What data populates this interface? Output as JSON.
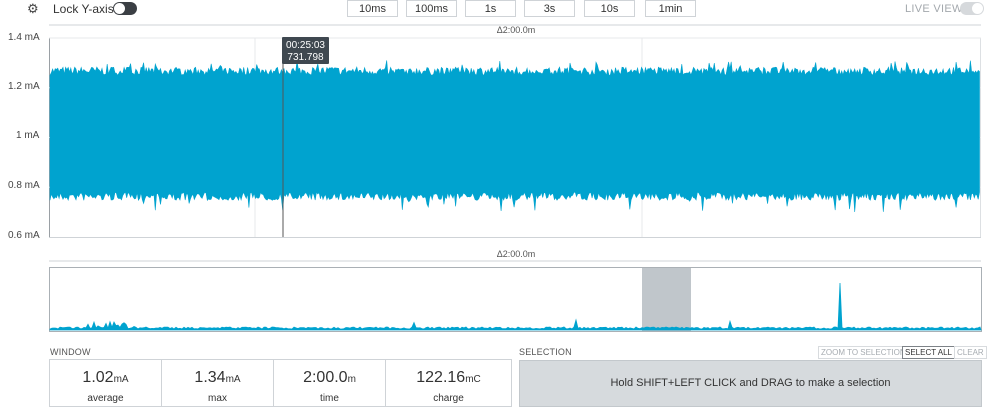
{
  "topbar": {
    "lock_y_axis_label": "Lock Y-axis",
    "lock_y_axis_on": true,
    "live_view_label": "LIVE VIEW",
    "live_view_on": false,
    "window_buttons": [
      "10ms",
      "100ms",
      "1s",
      "3s",
      "10s",
      "1min"
    ]
  },
  "main_chart": {
    "window_delta": "Δ2:00.0m",
    "y_ticks": [
      "1.4 mA",
      "1.2 mA",
      "1 mA",
      "0.8 mA",
      "0.6 mA"
    ],
    "cursor_tooltip": {
      "time": "00:25:03",
      "value": "731.798"
    },
    "signal_color": "#00a3cf"
  },
  "overview_chart": {
    "window_delta": "Δ2:00.0m"
  },
  "window_panel": {
    "title": "WINDOW",
    "stats": [
      {
        "value": "1.02",
        "unit": "mA",
        "label": "average"
      },
      {
        "value": "1.34",
        "unit": "mA",
        "label": "max"
      },
      {
        "value": "2:00.0",
        "unit": "m",
        "label": "time"
      },
      {
        "value": "122.16",
        "unit": "mC",
        "label": "charge"
      }
    ]
  },
  "selection_panel": {
    "title": "SELECTION",
    "zoom_to_selection": "ZOOM TO SELECTION",
    "select_all": "SELECT ALL",
    "clear": "CLEAR",
    "hint": "Hold SHIFT+LEFT CLICK and DRAG to make a selection"
  },
  "chart_data": {
    "type": "area",
    "title": "",
    "xlabel": "",
    "ylabel": "",
    "ylim": [
      0.6,
      1.4
    ],
    "y_unit": "mA",
    "y_tick_labels": [
      "1.4 mA",
      "1.2 mA",
      "1 mA",
      "0.8 mA",
      "0.6 mA"
    ],
    "grid": true,
    "series": [
      {
        "band_min": 0.76,
        "band_max": 1.27,
        "peak_min": 0.7,
        "peak_max": 1.31
      }
    ],
    "cursor": {
      "time": "00:25:03",
      "value": 731.798
    }
  }
}
